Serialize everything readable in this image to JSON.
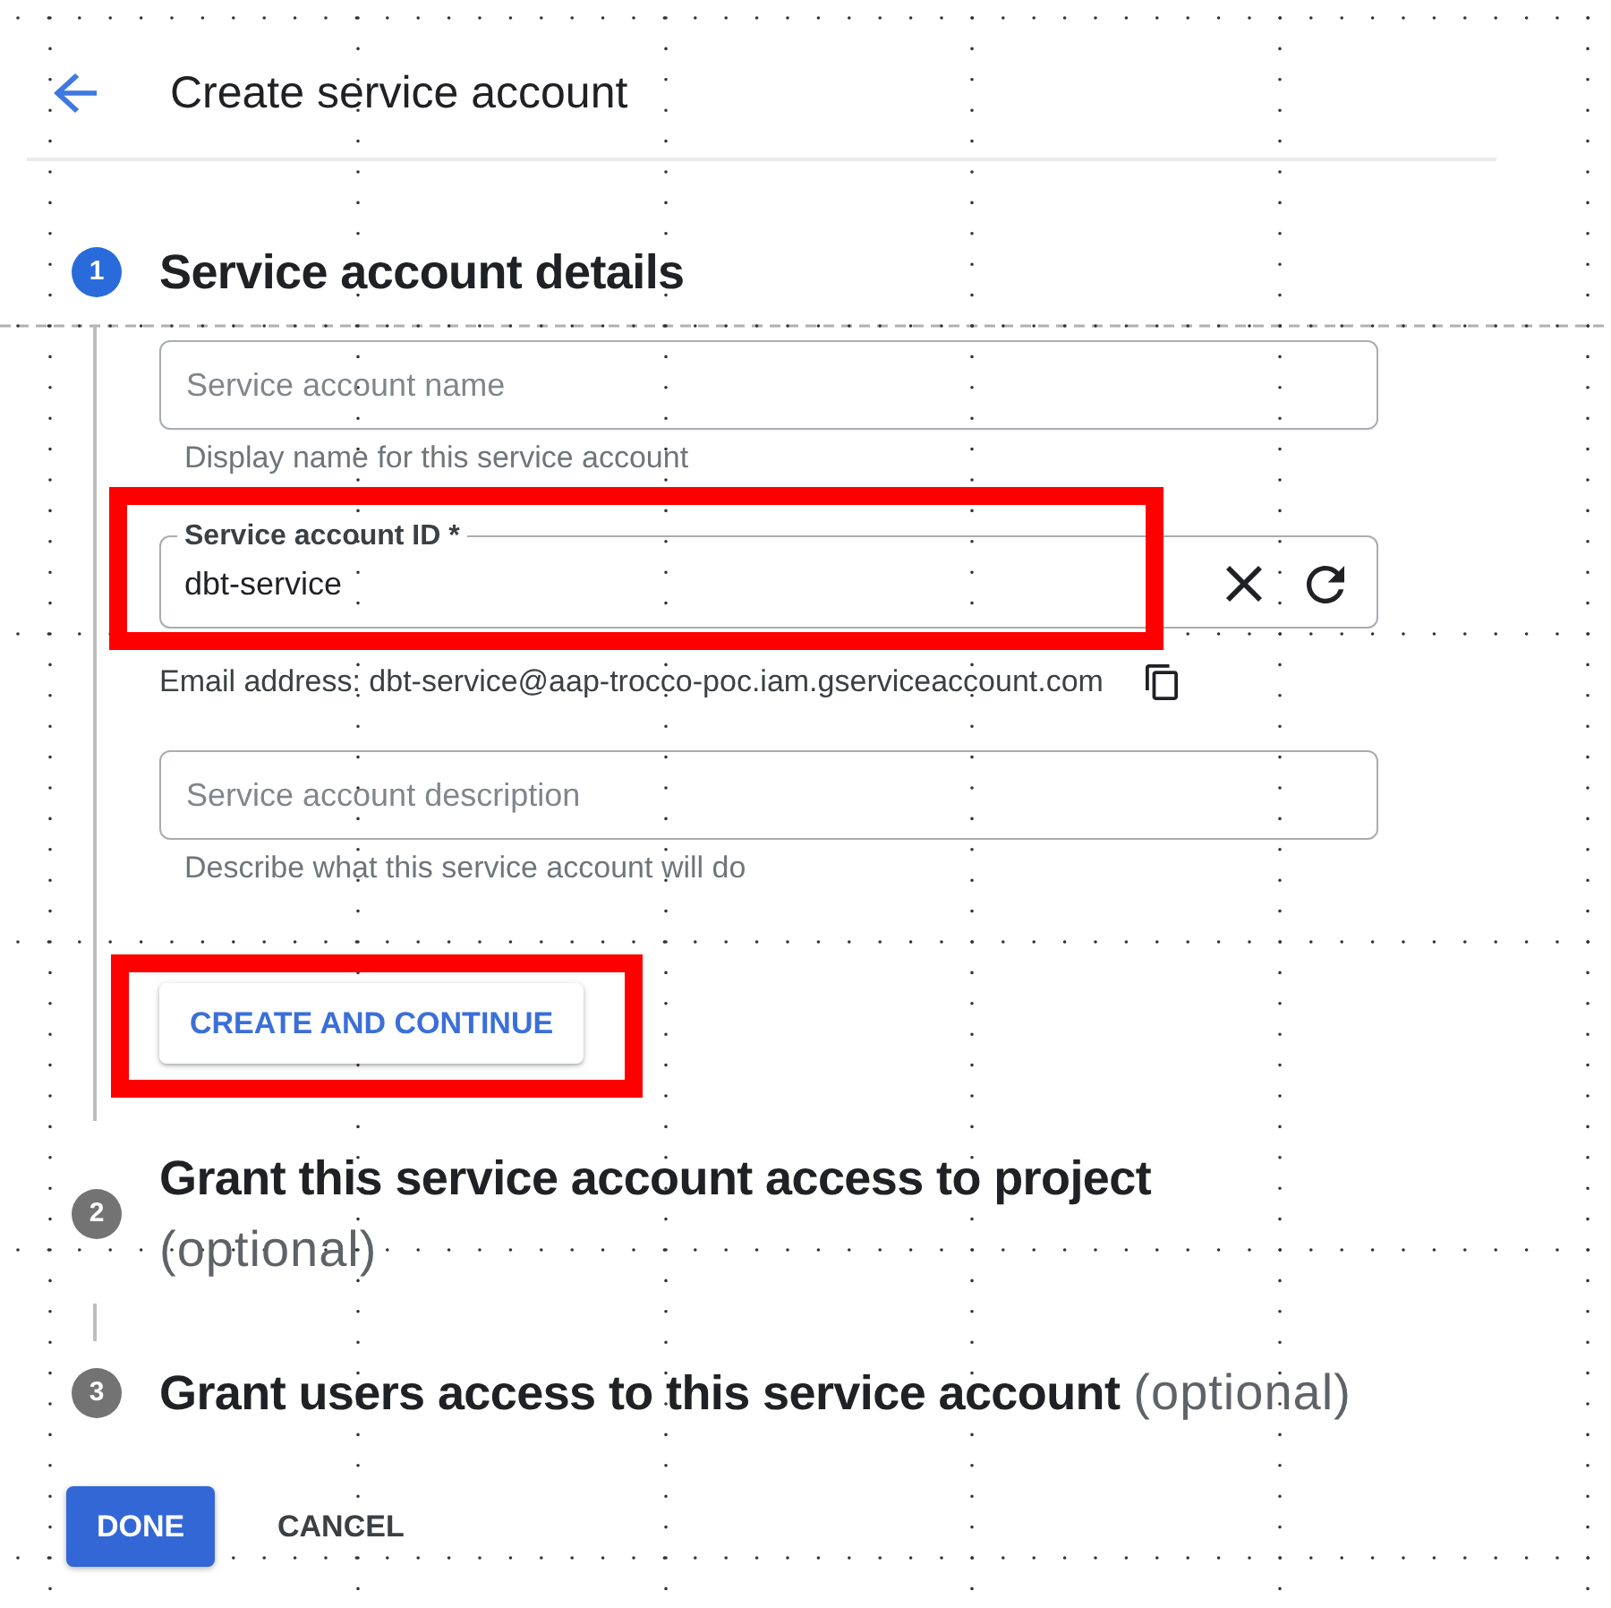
{
  "header": {
    "title": "Create service account"
  },
  "steps": [
    {
      "number": "1",
      "title": "Service account details",
      "active": true,
      "form": [
        {
          "kind": "text_field",
          "placeholder": "Service account name",
          "helper": "Display name for this service account",
          "highlighted": false
        },
        {
          "kind": "id_field",
          "label": "Service account ID *",
          "value": "dbt-service",
          "highlighted": true
        },
        {
          "kind": "email_line",
          "text": "Email address: dbt-service@aap-trocco-poc.iam.gserviceaccount.com"
        },
        {
          "kind": "text_field",
          "placeholder": "Service account description",
          "helper": "Describe what this service account will do",
          "highlighted": false
        }
      ],
      "submit": {
        "label": "CREATE AND CONTINUE",
        "highlighted": true
      }
    },
    {
      "number": "2",
      "title": "Grant this service account access to project",
      "note": "(optional)",
      "active": false
    },
    {
      "number": "3",
      "title": "Grant users access to this service account",
      "note": "(optional)",
      "active": false
    }
  ],
  "actions": [
    {
      "kind": "primary",
      "label": "DONE"
    },
    {
      "kind": "text",
      "label": "CANCEL"
    }
  ]
}
